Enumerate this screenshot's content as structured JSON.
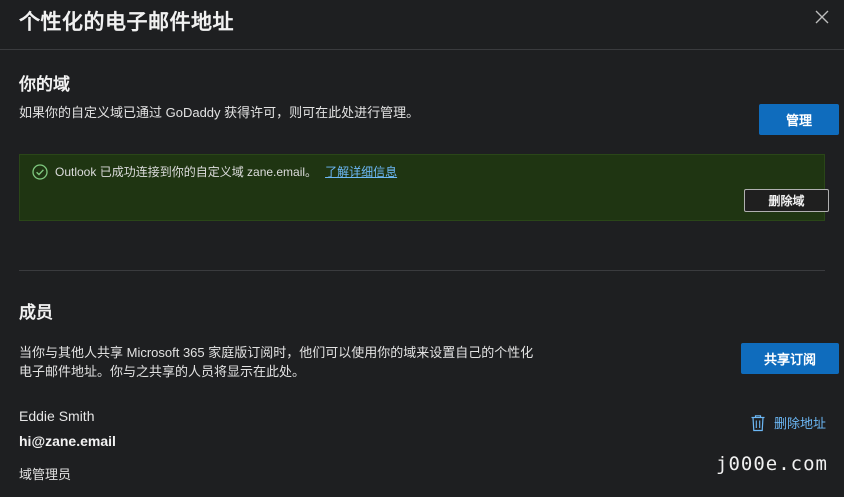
{
  "dialog": {
    "title": "个性化的电子邮件地址",
    "close_icon": "close-icon"
  },
  "domain_section": {
    "title": "你的域",
    "description": "如果你的自定义域已通过 GoDaddy 获得许可，则可在此处进行管理。",
    "manage_label": "管理",
    "success": {
      "icon": "check-circle-icon",
      "message": "Outlook 已成功连接到你的自定义域 zane.email。",
      "link_label": "了解详细信息",
      "delete_domain_label": "删除域"
    }
  },
  "members_section": {
    "title": "成员",
    "description_line1": "当你与其他人共享 Microsoft 365 家庭版订阅时，他们可以使用你的域来设置自己的个性化",
    "description_line2": "电子邮件地址。你与之共享的人员将显示在此处。",
    "share_label": "共享订阅",
    "member": {
      "name": "Eddie Smith",
      "email": "hi@zane.email",
      "role": "域管理员"
    },
    "remove_address_label": "删除地址",
    "remove_icon": "trash-icon"
  },
  "watermark": "j000e.com",
  "colors": {
    "background": "#1e1f21",
    "accent": "#0f6cbd",
    "link": "#6cb8f6",
    "success_bg": "#1f3512",
    "success_icon": "#7fc97f"
  }
}
